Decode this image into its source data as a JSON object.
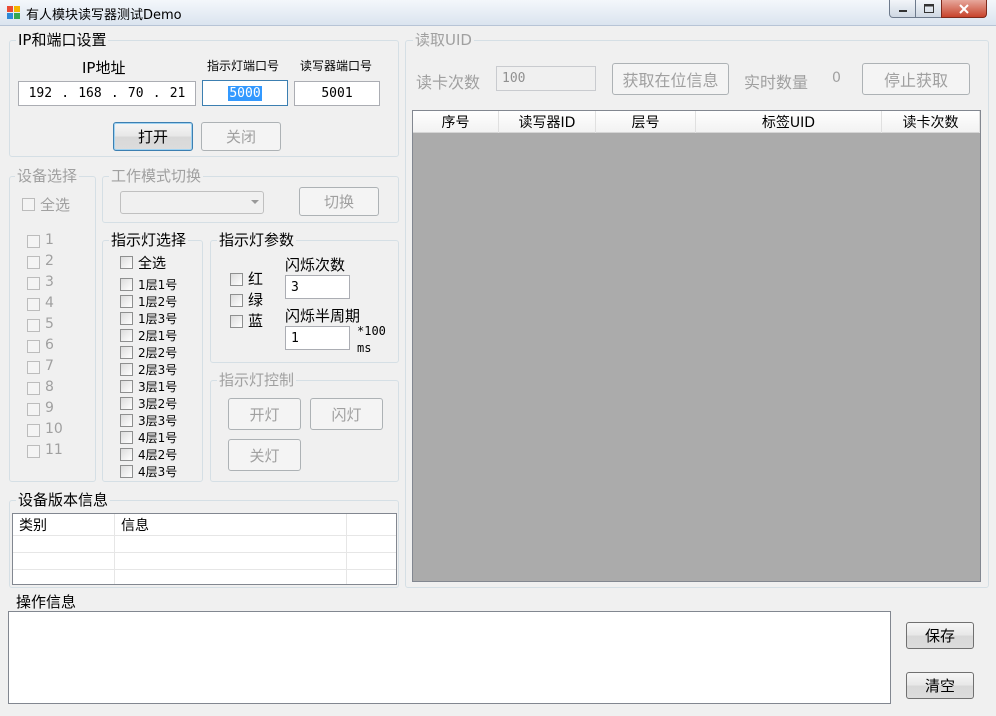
{
  "window": {
    "title": "有人模块读写器测试Demo"
  },
  "ip_group": {
    "legend": "IP和端口设置",
    "ip_label": "IP地址",
    "ip_octets": [
      "192",
      "168",
      "70",
      "21"
    ],
    "ip_dot": ".",
    "light_port_label": "指示灯端口号",
    "light_port_value": "5000",
    "reader_port_label": "读写器端口号",
    "reader_port_value": "5001",
    "open_button": "打开",
    "close_button": "关闭"
  },
  "device_select": {
    "legend": "设备选择",
    "select_all": "全选",
    "devices": [
      "1",
      "2",
      "3",
      "4",
      "5",
      "6",
      "7",
      "8",
      "9",
      "10",
      "11"
    ]
  },
  "work_mode": {
    "legend": "工作模式切换",
    "dropdown_value": "",
    "switch_button": "切换"
  },
  "light_select": {
    "legend": "指示灯选择",
    "select_all": "全选",
    "lights": [
      "1层1号",
      "1层2号",
      "1层3号",
      "2层1号",
      "2层2号",
      "2层3号",
      "3层1号",
      "3层2号",
      "3层3号",
      "4层1号",
      "4层2号",
      "4层3号"
    ]
  },
  "light_params": {
    "legend": "指示灯参数",
    "colors": [
      "红",
      "绿",
      "蓝"
    ],
    "blink_count_label": "闪烁次数",
    "blink_count_value": "3",
    "half_period_label": "闪烁半周期",
    "half_period_value": "1",
    "unit_line1": "*100",
    "unit_line2": "ms"
  },
  "light_control": {
    "legend": "指示灯控制",
    "on_button": "开灯",
    "blink_button": "闪灯",
    "off_button": "关灯"
  },
  "version_info": {
    "legend": "设备版本信息",
    "columns": [
      "类别",
      "信息"
    ]
  },
  "read_uid": {
    "legend": "读取UID",
    "read_count_label": "读卡次数",
    "read_count_value": "100",
    "get_button": "获取在位信息",
    "realtime_label": "实时数量",
    "realtime_value": "0",
    "stop_button": "停止获取",
    "columns": [
      "序号",
      "读写器ID",
      "层号",
      "标签UID",
      "读卡次数"
    ]
  },
  "operation": {
    "label": "操作信息",
    "save_button": "保存",
    "clear_button": "清空"
  },
  "colors": {
    "grid_background": "#ababab",
    "title_close": "#c7432c"
  }
}
